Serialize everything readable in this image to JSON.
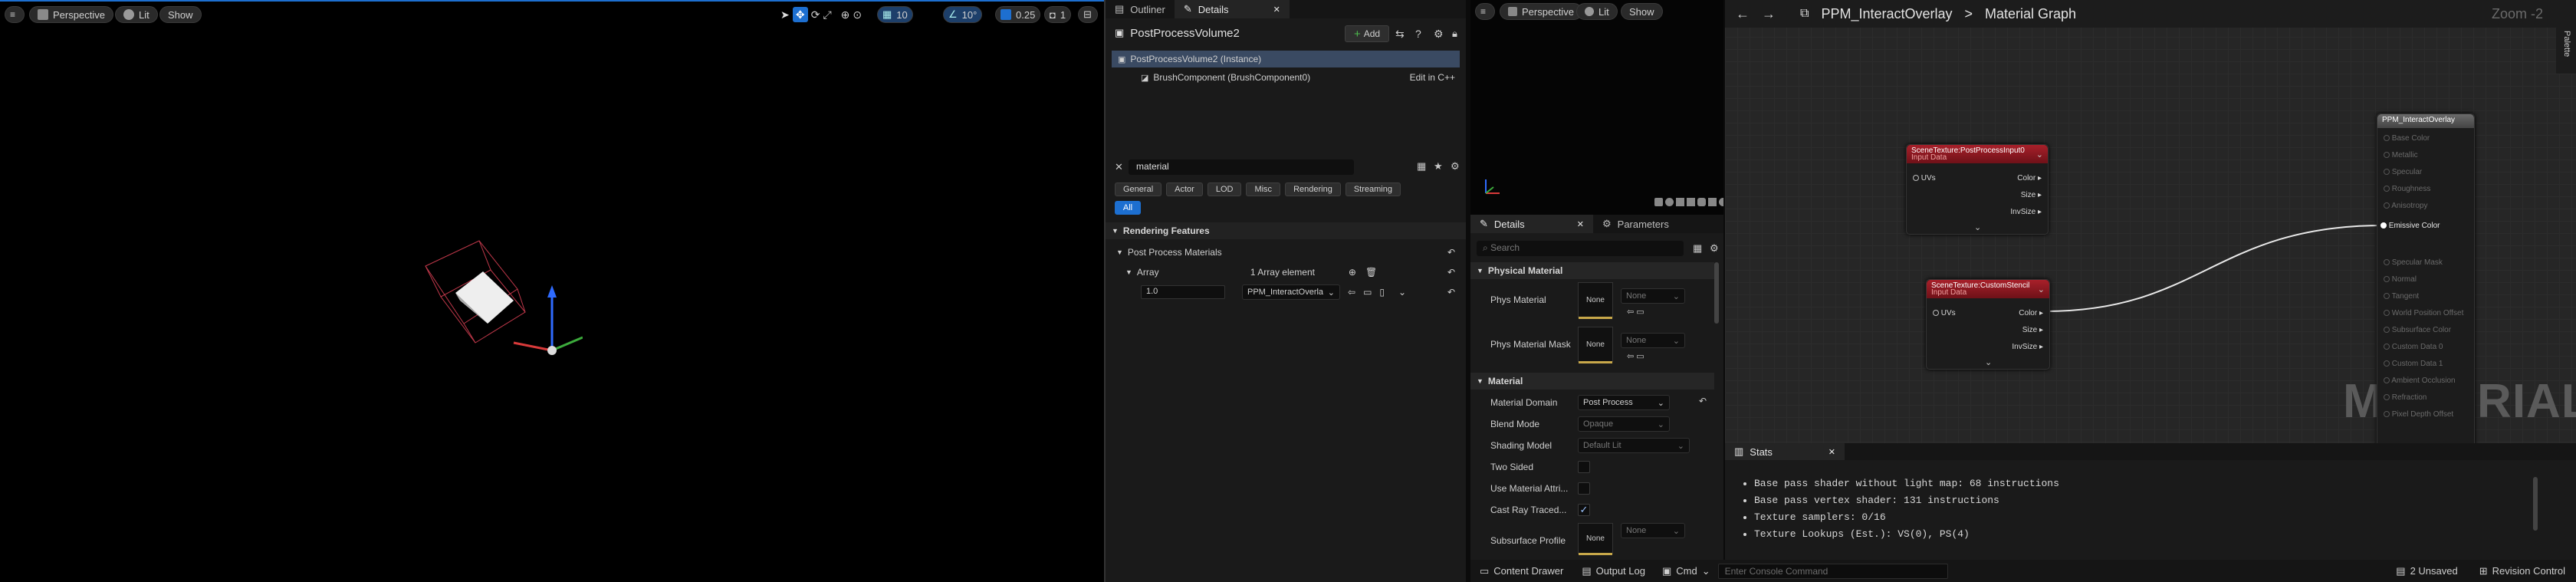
{
  "viewport1": {
    "perspective": "Perspective",
    "lit": "Lit",
    "show": "Show",
    "grid_snap": "10",
    "rot_snap": "10°",
    "scale_snap": "0.25",
    "cam_speed": "1"
  },
  "outliner": {
    "tab_outliner": "Outliner",
    "tab_details": "Details",
    "title": "PostProcessVolume2",
    "add_label": "Add",
    "instance_row": "PostProcessVolume2 (Instance)",
    "component_row": "BrushComponent (BrushComponent0)",
    "edit_cpp": "Edit in C++"
  },
  "details": {
    "search_value": "material",
    "filters": [
      "General",
      "Actor",
      "LOD",
      "Misc",
      "Rendering",
      "Streaming"
    ],
    "filter_all": "All",
    "section_rendering": "Rendering Features",
    "post_process_materials": "Post Process Materials",
    "array_label": "Array",
    "array_count": "1 Array element",
    "weight": "1.0",
    "material_value": "PPM_InteractOverla"
  },
  "viewport2": {
    "perspective": "Perspective",
    "lit": "Lit",
    "show": "Show"
  },
  "mat_details": {
    "tab_details": "Details",
    "tab_parameters": "Parameters",
    "search_placeholder": "Search",
    "section_physical": "Physical Material",
    "phys_material": "Phys Material",
    "phys_material_mask": "Phys Material Mask",
    "none": "None",
    "section_material": "Material",
    "material_domain_label": "Material Domain",
    "material_domain_value": "Post Process",
    "blend_mode_label": "Blend Mode",
    "blend_mode_value": "Opaque",
    "shading_model_label": "Shading Model",
    "shading_model_value": "Default Lit",
    "two_sided": "Two Sided",
    "use_material_attr": "Use Material Attri...",
    "cast_ray_traced": "Cast Ray Traced...",
    "subsurface_profile": "Subsurface Profile"
  },
  "graph": {
    "breadcrumb_asset": "PPM_InteractOverlay",
    "breadcrumb_sep": ">",
    "breadcrumb_graph": "Material Graph",
    "zoom": "Zoom -2",
    "palette": "Palette",
    "watermark": "MATERIAL",
    "node1": {
      "title": "SceneTexture:PostProcessInput0",
      "subtitle": "Input Data",
      "input": "UVs",
      "outputs": [
        "Color",
        "Size",
        "InvSize"
      ]
    },
    "node2": {
      "title": "SceneTexture:CustomStencil",
      "subtitle": "Input Data",
      "input": "UVs",
      "outputs": [
        "Color",
        "Size",
        "InvSize"
      ]
    },
    "result": {
      "title": "PPM_InteractOverlay",
      "emissive": "Emissive Color",
      "pins": [
        "Base Color",
        "Metallic",
        "Specular",
        "Roughness",
        "Anisotropy",
        "Specular Mask",
        "Normal",
        "Tangent",
        "World Position Offset",
        "Subsurface Color",
        "Custom Data 0",
        "Custom Data 1",
        "Ambient Occlusion",
        "Refraction",
        "Pixel Depth Offset"
      ]
    }
  },
  "stats": {
    "tab": "Stats",
    "lines": [
      "Base pass shader without light map: 68 instructions",
      "Base pass vertex shader: 131 instructions",
      "Texture samplers: 0/16",
      "Texture Lookups (Est.): VS(0), PS(4)"
    ]
  },
  "statusbar": {
    "content_drawer": "Content Drawer",
    "output_log": "Output Log",
    "cmd": "Cmd",
    "console_placeholder": "Enter Console Command",
    "unsaved": "2 Unsaved",
    "revision_control": "Revision Control"
  }
}
